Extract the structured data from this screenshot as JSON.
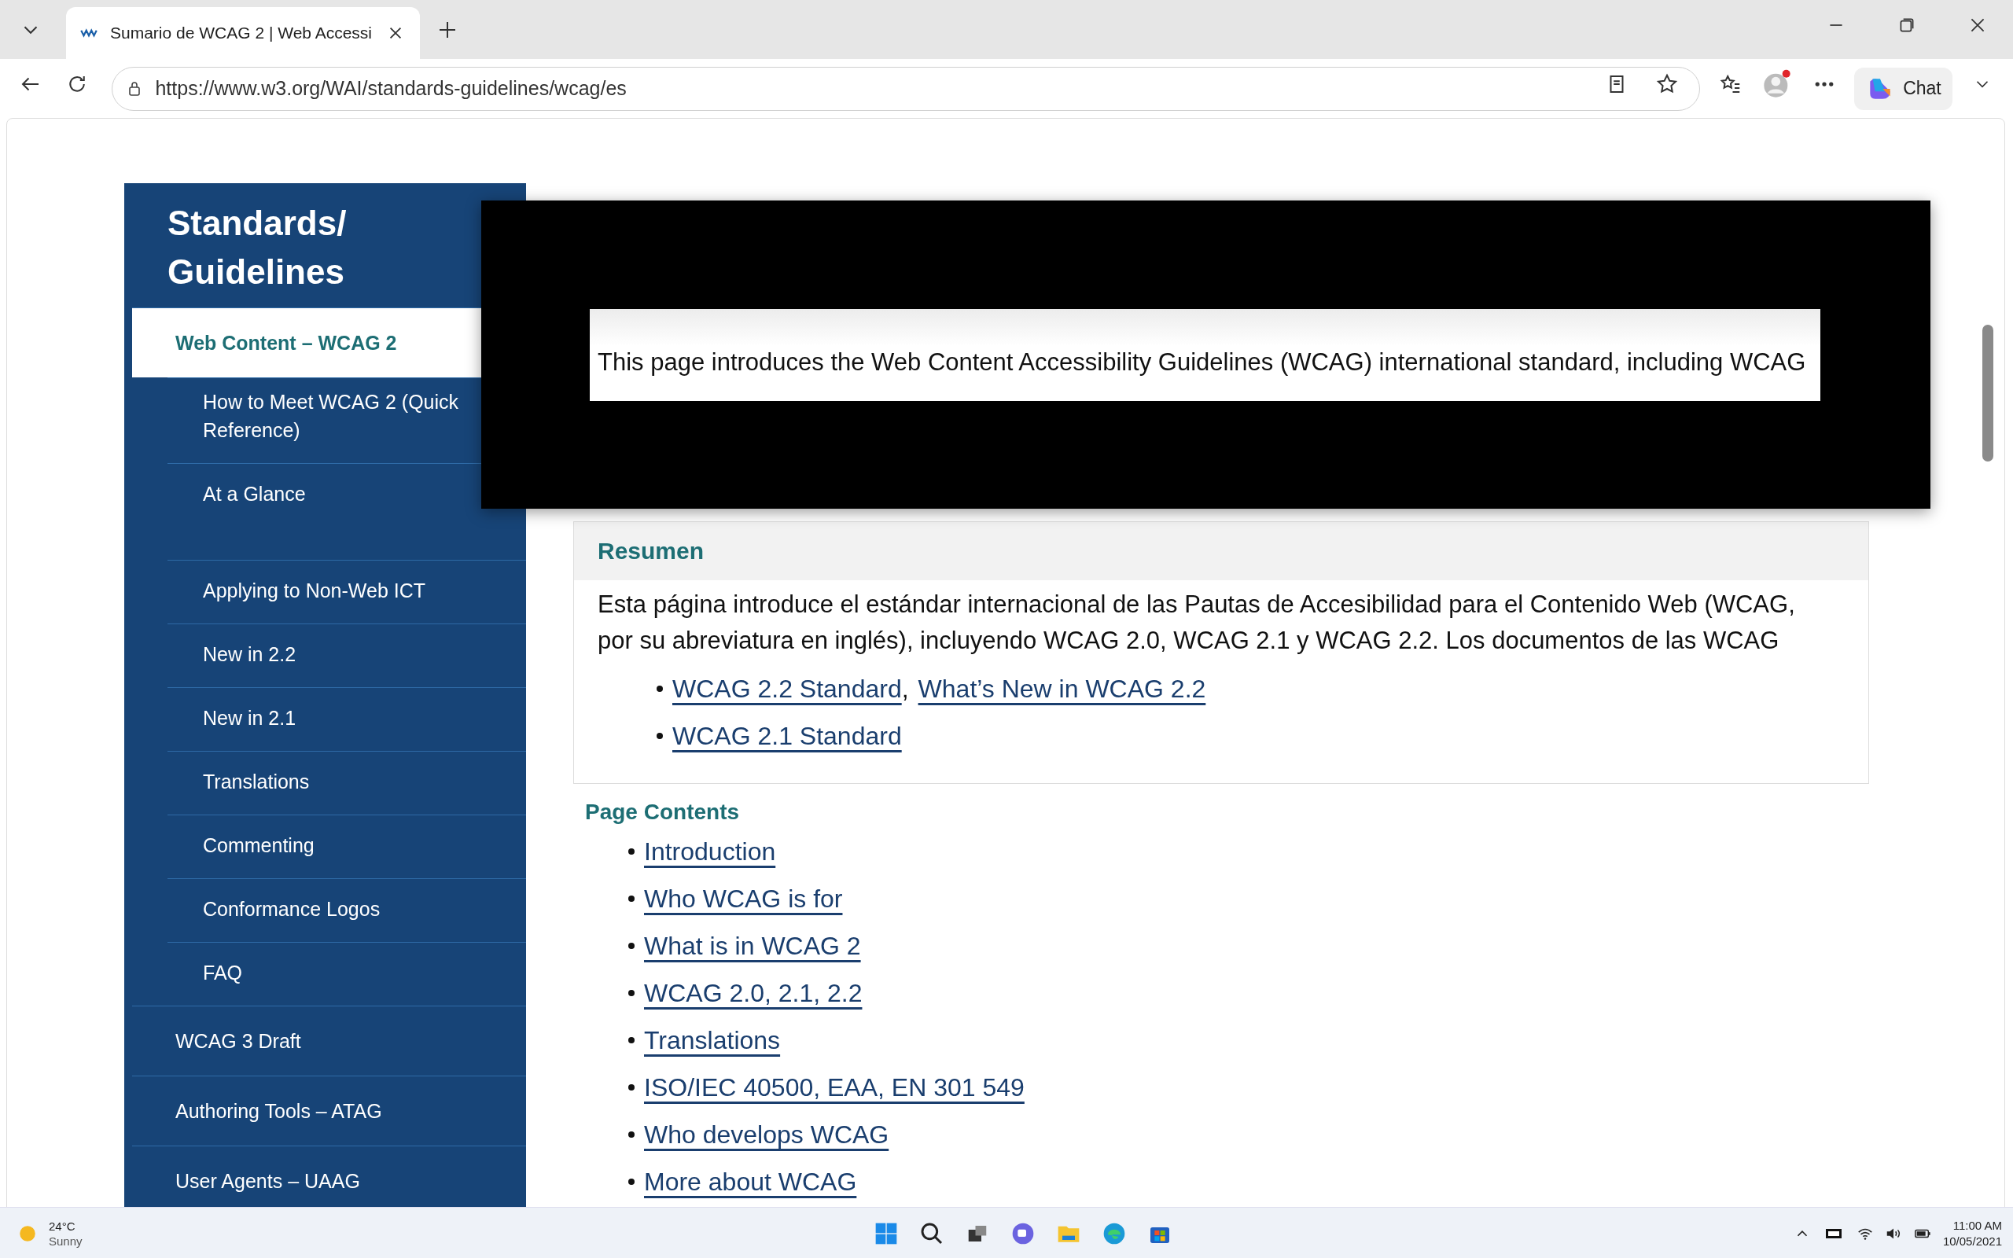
{
  "browser": {
    "tab": {
      "title": "Sumario de WCAG 2 | Web Accessi"
    },
    "url": "https://www.w3.org/WAI/standards-guidelines/wcag/es",
    "chat_label": "Chat"
  },
  "sidebar": {
    "title": "Standards/ Guidelines",
    "items": [
      {
        "label": "Web Content – WCAG 2",
        "selected": true,
        "children": [
          {
            "label": "How to Meet WCAG 2 (Quick Reference)",
            "selected": false
          },
          {
            "label": "At a Glance",
            "selected": false
          },
          {
            "label": "Applying to Non-Web ICT",
            "selected": false
          },
          {
            "label": "New in 2.2",
            "selected": false
          },
          {
            "label": "New in 2.1",
            "selected": false
          },
          {
            "label": "Translations",
            "selected": false
          },
          {
            "label": "Commenting",
            "selected": false
          },
          {
            "label": "Conformance Logos",
            "selected": false
          },
          {
            "label": "FAQ",
            "selected": false
          }
        ]
      },
      {
        "label": "WCAG 3 Draft",
        "selected": false
      },
      {
        "label": "Authoring Tools – ATAG",
        "selected": false
      },
      {
        "label": "User Agents – UAAG",
        "selected": false
      }
    ]
  },
  "overlay": {
    "text": "This page introduces the Web Content Accessibility Guidelines (WCAG) international standard, including WCAG"
  },
  "summary": {
    "heading": "Resumen",
    "lines": [
      "Esta página introduce el estándar internacional de las Pautas de Accesibilidad para el Contenido Web (WCAG,",
      "por su abreviatura en inglés), incluyendo WCAG 2.0, WCAG 2.1 y WCAG 2.2. Los documentos de las WCAG"
    ],
    "items": [
      [
        {
          "kind": "link",
          "text": "WCAG 2.2 Standard"
        },
        {
          "kind": "text",
          "text": ","
        },
        {
          "kind": "link",
          "text": "What’s New in WCAG 2.2"
        }
      ],
      [
        {
          "kind": "link",
          "text": "WCAG 2.1 Standard"
        }
      ]
    ]
  },
  "page_contents": {
    "heading": "Page Contents",
    "items": [
      "Introduction",
      "Who WCAG is for",
      "What is in WCAG 2",
      "WCAG 2.0, 2.1, 2.2",
      "Translations",
      "ISO/IEC 40500, EAA, EN 301 549",
      "Who develops WCAG",
      "More about WCAG"
    ]
  },
  "taskbar": {
    "weather": {
      "temperature": "24°C",
      "condition": "Sunny"
    },
    "time": "11:00 AM",
    "date": "10/05/2021"
  }
}
